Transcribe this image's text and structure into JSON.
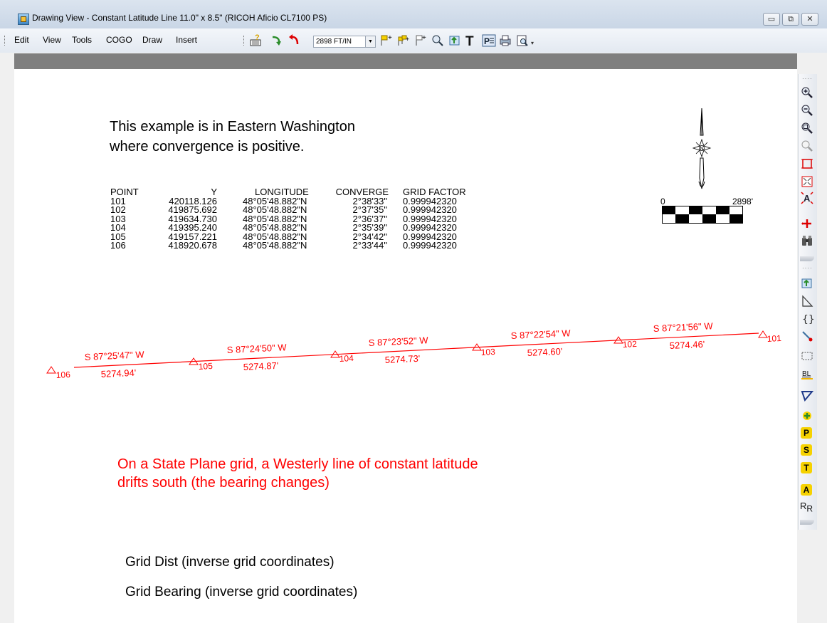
{
  "window": {
    "title": "Drawing View - Constant Latitude Line  11.0\" x 8.5\" (RICOH Aficio CL7100 PS)",
    "controls": {
      "minimize": "▭",
      "restore": "⧉",
      "close": "✕"
    }
  },
  "menu": [
    "Edit",
    "View",
    "Tools",
    "COGO",
    "Draw",
    "Insert"
  ],
  "toolbar": {
    "scale": "2898 FT/IN"
  },
  "notes": {
    "intro_line1": "This example is in Eastern Washington",
    "intro_line2": "where convergence is positive.",
    "red_line1": "On a State Plane grid, a Westerly line of constant latitude",
    "red_line2": "drifts south (the bearing changes)",
    "legend_dist": "Grid Dist (inverse grid coordinates)",
    "legend_bearing": "Grid Bearing (inverse grid coordinates)"
  },
  "table": {
    "headers": [
      "POINT",
      "Y",
      "LONGITUDE",
      "CONVERGE",
      "GRID FACTOR"
    ],
    "rows": [
      [
        "101",
        "420118.126",
        "48°05'48.882\"N",
        "2°38'33\"",
        "0.999942320"
      ],
      [
        "102",
        "419875.692",
        "48°05'48.882\"N",
        "2°37'35\"",
        "0.999942320"
      ],
      [
        "103",
        "419634.730",
        "48°05'48.882\"N",
        "2°36'37\"",
        "0.999942320"
      ],
      [
        "104",
        "419395.240",
        "48°05'48.882\"N",
        "2°35'39\"",
        "0.999942320"
      ],
      [
        "105",
        "419157.221",
        "48°05'48.882\"N",
        "2°34'42\"",
        "0.999942320"
      ],
      [
        "106",
        "418920.678",
        "48°05'48.882\"N",
        "2°33'44\"",
        "0.999942320"
      ]
    ]
  },
  "scale_bar": {
    "zero": "0",
    "end": "2898'"
  },
  "traverse": {
    "color": "#ff0000",
    "points": [
      "106",
      "105",
      "104",
      "103",
      "102",
      "101"
    ],
    "segments": [
      {
        "bearing": "S 87°25'47\" W",
        "distance": "5274.94'"
      },
      {
        "bearing": "S 87°24'50\" W",
        "distance": "5274.87'"
      },
      {
        "bearing": "S 87°23'52\" W",
        "distance": "5274.73'"
      },
      {
        "bearing": "S 87°22'54\" W",
        "distance": "5274.60'"
      },
      {
        "bearing": "S 87°21'56\" W",
        "distance": "5274.46'"
      }
    ]
  },
  "right_toolbar": {
    "icons": [
      "zoom-in-icon",
      "zoom-out-icon",
      "zoom-window-icon",
      "zoom-previous-icon",
      "zoom-extents-icon",
      "zoom-all-icon",
      "text-icon",
      "pan-icon",
      "binoculars-icon",
      "layer-icon",
      "polyline-icon",
      "curve-icon",
      "snap-icon",
      "rectangle-icon",
      "baseline-icon",
      "polygon-icon",
      "add-point-icon"
    ],
    "letters": [
      "P",
      "S",
      "T",
      "A"
    ],
    "rr_label": "R",
    "rr_sub": "R"
  }
}
